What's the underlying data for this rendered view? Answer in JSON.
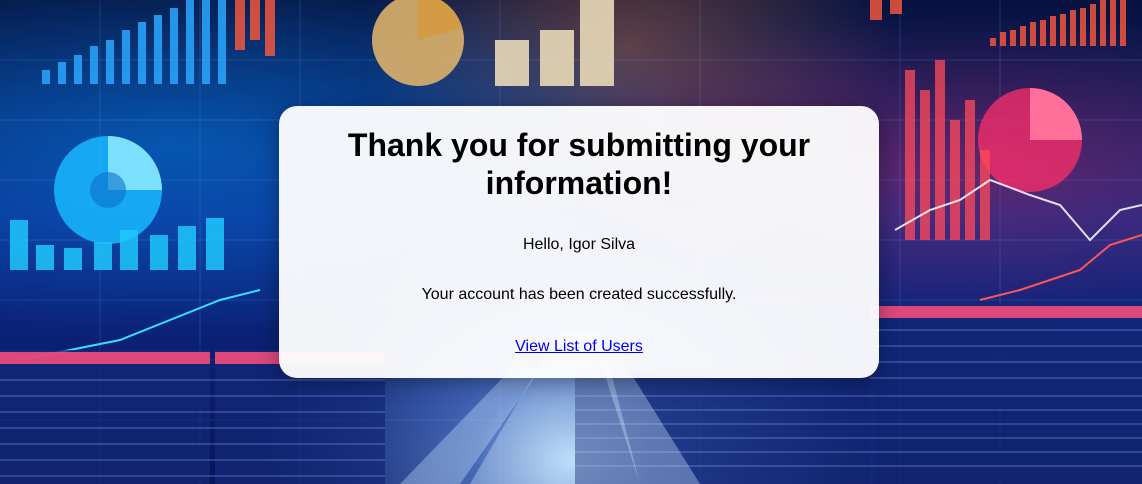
{
  "confirmation": {
    "title": "Thank you for submitting your information!",
    "greeting": "Hello, Igor Silva",
    "message": "Your account has been created successfully.",
    "users_link": "View List of Users"
  }
}
